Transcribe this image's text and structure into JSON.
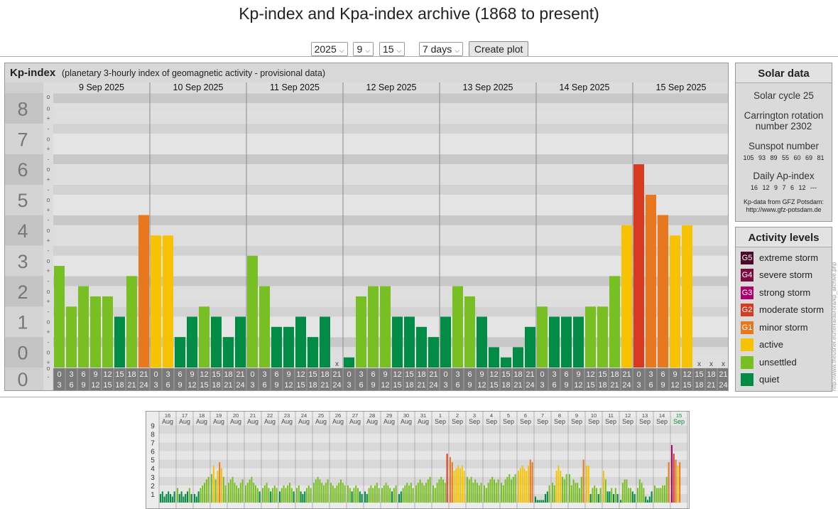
{
  "page": {
    "title": "Kp-index and Kpa-index archive (1868 to present)"
  },
  "controls": {
    "year": "2025",
    "month": "9",
    "day": "15",
    "range": "7 days",
    "button": "Create plot"
  },
  "kp_panel": {
    "title": "Kp-index",
    "subtitle": "(planetary 3-hourly index of geomagnetic activity - provisional data)"
  },
  "solar": {
    "heading": "Solar data",
    "cycle": "Solar cycle 25",
    "carrington": "Carrington rotation number 2302",
    "sunspot_label": "Sunspot number",
    "sunspot_values": "105 93 89 55 60 69 81",
    "ap_label": "Daily Ap-index",
    "ap_values": "16 12 9 7 6 12 ---",
    "source": "Kp-data from GFZ Potsdam: http://www.gfz-potsdam.de"
  },
  "levels": {
    "heading": "Activity levels",
    "items": [
      {
        "tag": "G5",
        "label": "extreme storm",
        "color": "#4a0a2a"
      },
      {
        "tag": "G4",
        "label": "severe storm",
        "color": "#7a0a40"
      },
      {
        "tag": "G3",
        "label": "strong storm",
        "color": "#b0006a"
      },
      {
        "tag": "G2",
        "label": "moderate storm",
        "color": "#d83a20"
      },
      {
        "tag": "G1",
        "label": "minor storm",
        "color": "#e8781e"
      },
      {
        "tag": "",
        "label": "active",
        "color": "#f7c300"
      },
      {
        "tag": "",
        "label": "unsettled",
        "color": "#77bf22"
      },
      {
        "tag": "",
        "label": "quiet",
        "color": "#008c44"
      }
    ]
  },
  "side_url": "http://www.theusner.eu/terra/aurora/kp_archive.php",
  "chart_data": [
    {
      "type": "bar",
      "title": "Kp-index",
      "y_ticks": [
        "0",
        "1",
        "2",
        "3",
        "4",
        "5",
        "6",
        "7",
        "8",
        "9"
      ],
      "y_minor": [
        "+",
        "o",
        "-"
      ],
      "ylim": [
        0,
        9
      ],
      "days": [
        "9 Sep 2025",
        "10 Sep 2025",
        "11 Sep 2025",
        "12 Sep 2025",
        "13 Sep 2025",
        "14 Sep 2025",
        "15 Sep 2025"
      ],
      "hour_top": [
        "0",
        "3",
        "6",
        "9",
        "12",
        "15",
        "18",
        "21"
      ],
      "hour_bot": [
        "3",
        "6",
        "9",
        "12",
        "15",
        "18",
        "21",
        "24"
      ],
      "missing_mark": "x",
      "values": [
        [
          3.333,
          2.0,
          2.667,
          2.333,
          2.333,
          1.667,
          3.0,
          5.0
        ],
        [
          4.333,
          4.333,
          1.0,
          1.667,
          2.0,
          1.667,
          1.0,
          1.667
        ],
        [
          3.667,
          2.667,
          1.333,
          1.333,
          1.667,
          1.0,
          1.667,
          null
        ],
        [
          0.333,
          2.333,
          2.667,
          2.667,
          1.667,
          1.667,
          1.333,
          1.0
        ],
        [
          1.667,
          2.667,
          2.333,
          1.667,
          0.667,
          0.333,
          0.667,
          1.333
        ],
        [
          2.0,
          1.667,
          1.667,
          1.667,
          2.0,
          2.0,
          3.0,
          4.667
        ],
        [
          6.667,
          5.667,
          5.0,
          4.333,
          4.667,
          null,
          null,
          null
        ]
      ]
    },
    {
      "type": "bar",
      "title": "",
      "y_ticks": [
        "1",
        "2",
        "3",
        "4",
        "5",
        "6",
        "7",
        "8",
        "9"
      ],
      "ylim": [
        0,
        9
      ],
      "dates": [
        [
          "16",
          "Aug"
        ],
        [
          "17",
          "Aug"
        ],
        [
          "18",
          "Aug"
        ],
        [
          "19",
          "Aug"
        ],
        [
          "20",
          "Aug"
        ],
        [
          "21",
          "Aug"
        ],
        [
          "22",
          "Aug"
        ],
        [
          "23",
          "Aug"
        ],
        [
          "24",
          "Aug"
        ],
        [
          "25",
          "Aug"
        ],
        [
          "26",
          "Aug"
        ],
        [
          "27",
          "Aug"
        ],
        [
          "28",
          "Aug"
        ],
        [
          "29",
          "Aug"
        ],
        [
          "30",
          "Aug"
        ],
        [
          "31",
          "Aug"
        ],
        [
          "1",
          "Sep"
        ],
        [
          "2",
          "Sep"
        ],
        [
          "3",
          "Sep"
        ],
        [
          "4",
          "Sep"
        ],
        [
          "5",
          "Sep"
        ],
        [
          "6",
          "Sep"
        ],
        [
          "7",
          "Sep"
        ],
        [
          "8",
          "Sep"
        ],
        [
          "9",
          "Sep"
        ],
        [
          "10",
          "Sep"
        ],
        [
          "11",
          "Sep"
        ],
        [
          "12",
          "Sep"
        ],
        [
          "13",
          "Sep"
        ],
        [
          "14",
          "Sep"
        ],
        [
          "15",
          "Sep"
        ]
      ],
      "values": [
        [
          1.0,
          1.3,
          0.7,
          1.0,
          1.3,
          1.0,
          0.7,
          1.3
        ],
        [
          1.7,
          1.0,
          1.3,
          0.7,
          1.0,
          1.3,
          1.7,
          1.0
        ],
        [
          1.0,
          0.7,
          1.3,
          1.7,
          2.0,
          2.3,
          2.7,
          3.0
        ],
        [
          3.3,
          4.3,
          2.7,
          3.7,
          4.7,
          4.0,
          3.0,
          2.0
        ],
        [
          2.3,
          2.7,
          3.0,
          2.3,
          2.0,
          1.7,
          2.3,
          2.7
        ],
        [
          2.0,
          2.3,
          2.7,
          3.0,
          2.3,
          2.0,
          1.7,
          1.3
        ],
        [
          1.7,
          2.0,
          2.3,
          1.7,
          1.3,
          1.7,
          2.0,
          1.7
        ],
        [
          1.3,
          1.7,
          2.0,
          1.7,
          2.0,
          2.3,
          1.7,
          1.3
        ],
        [
          1.7,
          2.0,
          1.3,
          1.0,
          1.3,
          1.7,
          2.0,
          1.7
        ],
        [
          2.3,
          2.7,
          3.0,
          2.7,
          2.3,
          2.0,
          2.3,
          2.7
        ],
        [
          2.3,
          2.0,
          1.7,
          2.0,
          2.3,
          2.7,
          2.3,
          2.0
        ],
        [
          2.0,
          1.7,
          1.3,
          1.7,
          2.0,
          1.7,
          1.3,
          1.0
        ],
        [
          1.3,
          1.0,
          1.7,
          2.0,
          1.7,
          2.0,
          2.3,
          1.7
        ],
        [
          1.7,
          2.0,
          2.3,
          2.0,
          1.7,
          1.3,
          1.7,
          2.0
        ],
        [
          1.0,
          1.3,
          1.7,
          2.0,
          2.3,
          2.0,
          2.3,
          1.7
        ],
        [
          2.0,
          2.3,
          2.7,
          2.3,
          2.0,
          2.3,
          2.7,
          3.0
        ],
        [
          2.0,
          1.7,
          2.3,
          2.7,
          3.0,
          2.7,
          2.3,
          5.7
        ],
        [
          5.3,
          4.7,
          3.7,
          4.0,
          4.3,
          4.0,
          4.3,
          3.7
        ],
        [
          3.0,
          2.7,
          3.0,
          2.3,
          2.7,
          2.3,
          2.0,
          2.3
        ],
        [
          2.0,
          1.7,
          2.3,
          2.7,
          3.0,
          2.7,
          2.3,
          2.7
        ],
        [
          2.3,
          2.0,
          2.7,
          3.0,
          3.3,
          2.7,
          3.0,
          3.3
        ],
        [
          3.7,
          4.0,
          4.3,
          4.0,
          3.7,
          4.3,
          5.0,
          4.7
        ],
        [
          0.7,
          0.3,
          0.3,
          0.3,
          0.3,
          1.0,
          1.3,
          2.0
        ],
        [
          2.3,
          2.0,
          3.7,
          4.3,
          3.7,
          3.0,
          2.7,
          3.3
        ],
        [
          3.3,
          2.0,
          2.7,
          2.3,
          2.3,
          1.7,
          3.0,
          5.0
        ],
        [
          4.3,
          4.3,
          1.0,
          1.7,
          2.0,
          1.7,
          1.0,
          1.7
        ],
        [
          3.7,
          2.7,
          1.3,
          1.3,
          1.7,
          1.0,
          1.7,
          1.0
        ],
        [
          0.3,
          2.3,
          2.7,
          2.7,
          1.7,
          1.7,
          1.3,
          1.0
        ],
        [
          1.7,
          2.7,
          2.3,
          1.7,
          0.7,
          0.3,
          0.7,
          1.3
        ],
        [
          2.0,
          1.7,
          1.7,
          1.7,
          2.0,
          2.0,
          3.0,
          4.7
        ],
        [
          6.7,
          5.7,
          5.0,
          4.3,
          4.7,
          null,
          null,
          null
        ]
      ]
    }
  ]
}
